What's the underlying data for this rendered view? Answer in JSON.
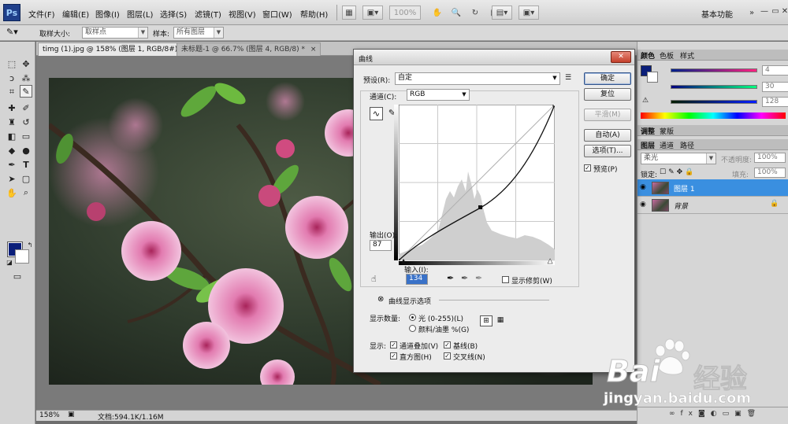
{
  "app": {
    "logo_text": "Ps",
    "menus": [
      "文件(F)",
      "编辑(E)",
      "图像(I)",
      "图层(L)",
      "选择(S)",
      "滤镜(T)",
      "视图(V)",
      "窗口(W)",
      "帮助(H)"
    ],
    "zoom_field": "100%",
    "workspace": "基本功能"
  },
  "options_bar": {
    "sample_size_label": "取样大小:",
    "sample_size_value": "取样点",
    "sample_label": "样本:",
    "sample_value": "所有图层"
  },
  "document": {
    "tabs": [
      "timg (1).jpg @ 158% (图层 1, RGB/8#) *",
      "未标题-1 @ 66.7% (图层 4, RGB/8) *"
    ],
    "status_zoom": "158%",
    "status_doc": "文档:594.1K/1.16M"
  },
  "curves_dialog": {
    "title": "曲线",
    "preset_label": "预设(R):",
    "preset_value": "自定",
    "channel_label": "通道(C):",
    "channel_value": "RGB",
    "output_label": "输出(O):",
    "output_value": "87",
    "input_label": "输入(I):",
    "input_value": "134",
    "show_clipping_label": "显示修剪(W)",
    "display_options_label": "曲线显示选项",
    "show_amount_label": "显示数量:",
    "light_option": "光 (0-255)(L)",
    "pigment_option": "颜料/油墨 %(G)",
    "show_label": "显示:",
    "channel_overlays": "通道叠加(V)",
    "baseline": "基线(B)",
    "histogram": "直方图(H)",
    "intersection": "交叉线(N)",
    "buttons": {
      "ok": "确定",
      "reset": "复位",
      "smooth": "平滑(M)",
      "auto": "自动(A)",
      "options": "选项(T)...",
      "preview": "预览(P)"
    }
  },
  "panels": {
    "color_tabs": [
      "颜色",
      "色板",
      "样式"
    ],
    "color_values": [
      "4",
      "30",
      "128"
    ],
    "adjust_tabs": [
      "调整",
      "蒙版"
    ],
    "layer_tabs": [
      "图层",
      "通道",
      "路径"
    ],
    "blend_mode": "柔光",
    "opacity_label": "不透明度:",
    "opacity_value": "100%",
    "lock_label": "锁定:",
    "fill_label": "填充:",
    "fill_value": "100%",
    "layers": [
      "图层 1",
      "背景"
    ],
    "fg_color": "#0b1f7a"
  },
  "watermark": {
    "brand_text": "Bai",
    "brand_cn": "经验",
    "url": "jingyan.baidu.com"
  }
}
